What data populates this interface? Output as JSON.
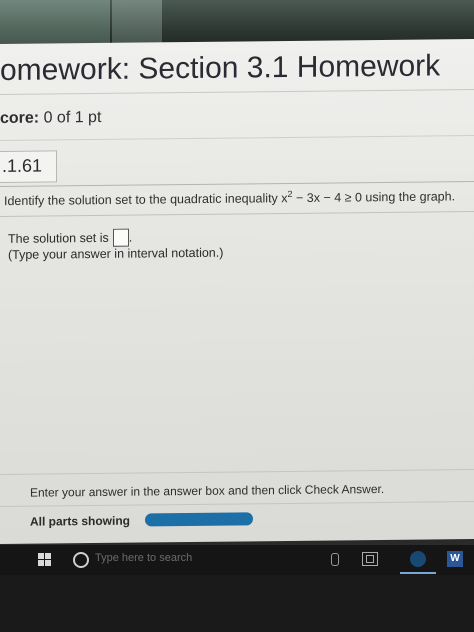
{
  "header": {
    "title": "omework: Section 3.1 Homework",
    "score_label": "core:",
    "score_value": "0 of 1 pt"
  },
  "question": {
    "number": ".1.61",
    "prompt_pre": "Identify the solution set to the quadratic inequality x",
    "prompt_exp": "2",
    "prompt_post": " − 3x − 4 ≥ 0 using the graph.",
    "solution_prefix": "The solution set is",
    "solution_suffix": ".",
    "hint": "(Type your answer in interval notation.)"
  },
  "footer": {
    "instruction": "Enter your answer in the answer box and then click Check Answer.",
    "parts_label": "All parts showing"
  },
  "taskbar": {
    "search_placeholder": "Type here to search",
    "word_icon_letter": "W"
  },
  "colors": {
    "progress": "#1d6fa8",
    "taskbar": "#151515"
  }
}
